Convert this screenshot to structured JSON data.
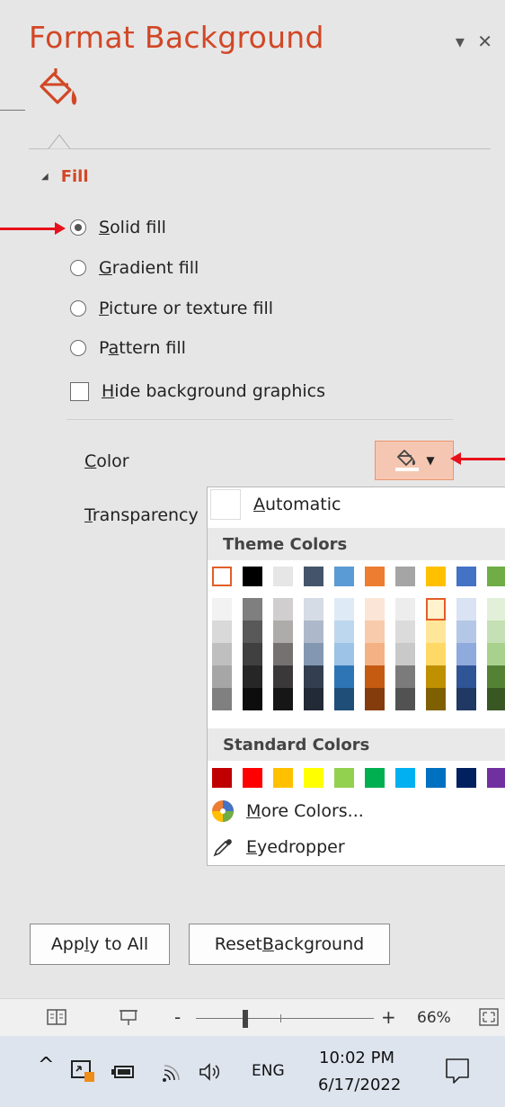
{
  "pane": {
    "title": "Format Background",
    "dropdown_glyph": "▾",
    "close_glyph": "✕",
    "section_title": "Fill",
    "fill_options": [
      {
        "pre": "",
        "key": "S",
        "post": "olid fill",
        "selected": true
      },
      {
        "pre": "",
        "key": "G",
        "post": "radient fill",
        "selected": false
      },
      {
        "pre": "",
        "key": "P",
        "post": "icture or texture fill",
        "selected": false
      },
      {
        "pre": "P",
        "key": "a",
        "post": "ttern fill",
        "selected": false
      }
    ],
    "hide_bg": {
      "pre": "",
      "key": "H",
      "post": "ide background graphics",
      "checked": false
    },
    "color_label": {
      "pre": "",
      "key": "C",
      "post": "olor"
    },
    "transparency_label": {
      "pre": "",
      "key": "T",
      "post": "ransparency"
    },
    "apply_all": {
      "pre": "App",
      "key": "l",
      "post": "y to All"
    },
    "reset_bg": {
      "pre": "Reset ",
      "key": "B",
      "post": "ackground"
    }
  },
  "picker": {
    "automatic": {
      "pre": "",
      "key": "A",
      "post": "utomatic"
    },
    "theme_header": "Theme Colors",
    "standard_header": "Standard Colors",
    "more_colors": {
      "pre": "",
      "key": "M",
      "post": "ore Colors..."
    },
    "eyedropper": {
      "pre": "",
      "key": "E",
      "post": "yedropper"
    },
    "theme_top": [
      "#ffffff",
      "#000000",
      "#e7e6e6",
      "#44546a",
      "#5b9bd5",
      "#ed7d31",
      "#a5a5a5",
      "#ffc000",
      "#4472c4",
      "#70ad47"
    ],
    "theme_shades": [
      [
        "#f2f2f2",
        "#d9d9d9",
        "#bfbfbf",
        "#a6a6a6",
        "#808080"
      ],
      [
        "#7f7f7f",
        "#595959",
        "#404040",
        "#262626",
        "#0d0d0d"
      ],
      [
        "#d0cece",
        "#aeabab",
        "#767171",
        "#3a3838",
        "#171616"
      ],
      [
        "#d6dce5",
        "#adb9ca",
        "#8497b0",
        "#333f50",
        "#222a35"
      ],
      [
        "#deebf7",
        "#bdd7ee",
        "#9dc3e6",
        "#2e75b6",
        "#1f4e79"
      ],
      [
        "#fbe5d6",
        "#f8cbad",
        "#f4b183",
        "#c55a11",
        "#843c0c"
      ],
      [
        "#ededed",
        "#dbdbdb",
        "#c9c9c9",
        "#7b7b7b",
        "#525252"
      ],
      [
        "#fff2cc",
        "#ffe699",
        "#ffd966",
        "#bf9000",
        "#7f6000"
      ],
      [
        "#dae3f3",
        "#b4c7e7",
        "#8faadc",
        "#2f5597",
        "#203864"
      ],
      [
        "#e2f0d9",
        "#c5e0b4",
        "#a9d18e",
        "#548235",
        "#385723"
      ]
    ],
    "standard": [
      "#c00000",
      "#ff0000",
      "#ffc000",
      "#ffff00",
      "#92d050",
      "#00b050",
      "#00b0f0",
      "#0070c0",
      "#002060",
      "#7030a0"
    ],
    "selected_color": "#fff2cc"
  },
  "status": {
    "zoom_minus": "-",
    "zoom_plus": "+",
    "zoom": "66%",
    "zoom_fraction": 0.28
  },
  "taskbar": {
    "lang": "ENG",
    "time": "10:02 PM",
    "date": "6/17/2022",
    "chevron": "^"
  },
  "colors": {
    "accent": "#d24726",
    "arrow": "#e8101a",
    "color_button_bg": "#f5c7b2"
  }
}
